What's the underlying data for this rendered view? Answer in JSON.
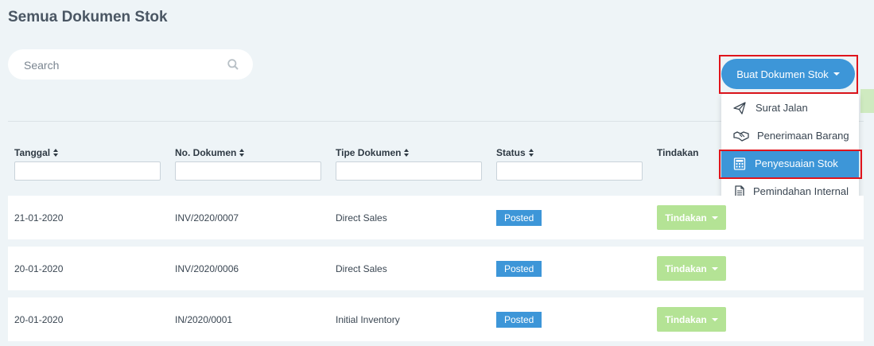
{
  "page": {
    "title": "Semua Dokumen Stok"
  },
  "search": {
    "placeholder": "Search"
  },
  "create_button": {
    "label": "Buat Dokumen Stok"
  },
  "dropdown": {
    "items": [
      {
        "label": "Surat Jalan",
        "icon": "paper-plane-icon"
      },
      {
        "label": "Penerimaan Barang",
        "icon": "handshake-icon"
      },
      {
        "label": "Penyesuaian Stok",
        "icon": "calculator-icon",
        "active": true
      },
      {
        "label": "Pemindahan Internal",
        "icon": "document-icon"
      }
    ]
  },
  "table": {
    "headers": [
      "Tanggal",
      "No. Dokumen",
      "Tipe Dokumen",
      "Status",
      "Tindakan"
    ],
    "rows": [
      {
        "tanggal": "21-01-2020",
        "no": "INV/2020/0007",
        "tipe": "Direct Sales",
        "status": "Posted",
        "action": "Tindakan"
      },
      {
        "tanggal": "20-01-2020",
        "no": "INV/2020/0006",
        "tipe": "Direct Sales",
        "status": "Posted",
        "action": "Tindakan"
      },
      {
        "tanggal": "20-01-2020",
        "no": "IN/2020/0001",
        "tipe": "Initial Inventory",
        "status": "Posted",
        "action": "Tindakan"
      }
    ]
  },
  "colors": {
    "accent": "#3d96d8",
    "action_green": "#b4e395",
    "highlight": "#e0141c"
  }
}
